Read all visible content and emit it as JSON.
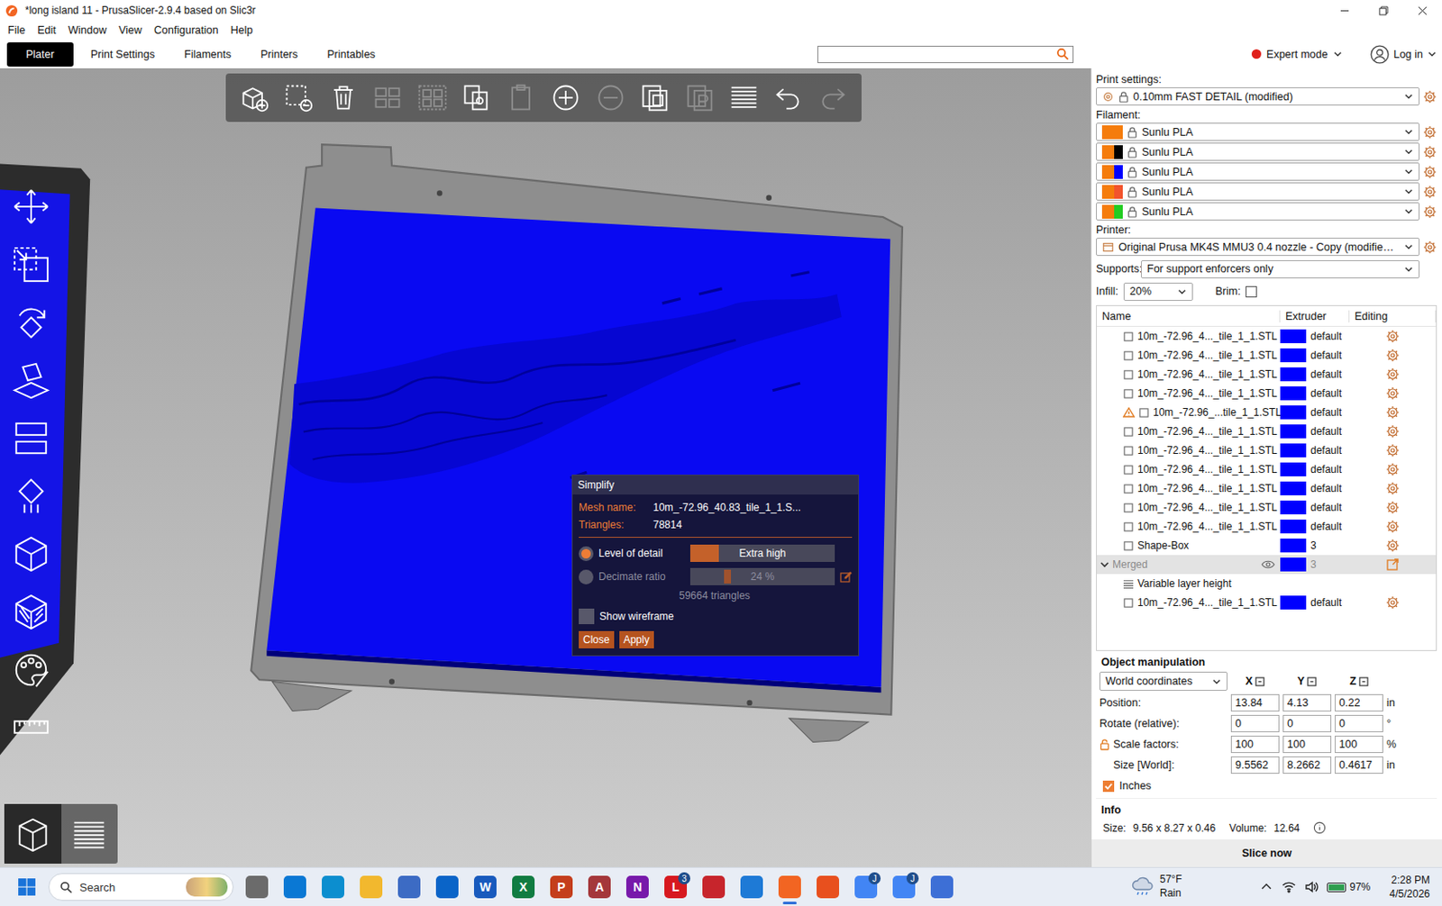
{
  "window": {
    "title": "*long island 11 - PrusaSlicer-2.9.4 based on Slic3r"
  },
  "menu": [
    "File",
    "Edit",
    "Window",
    "View",
    "Configuration",
    "Help"
  ],
  "tabs": [
    {
      "label": "Plater",
      "selected": true
    },
    {
      "label": "Print Settings",
      "selected": false
    },
    {
      "label": "Filaments",
      "selected": false
    },
    {
      "label": "Printers",
      "selected": false
    },
    {
      "label": "Printables",
      "selected": false
    }
  ],
  "mode": {
    "label": "Expert mode",
    "color": "#e0201b"
  },
  "login": "Log in",
  "toolbar": [
    {
      "kind": "add",
      "disabled": false
    },
    {
      "kind": "delete",
      "disabled": false
    },
    {
      "kind": "delete-all",
      "disabled": false
    },
    {
      "kind": "arrange",
      "disabled": true
    },
    {
      "kind": "arrange-selection",
      "disabled": true
    },
    {
      "kind": "copy",
      "disabled": false
    },
    {
      "kind": "paste",
      "disabled": true
    },
    {
      "kind": "add-instance",
      "disabled": false
    },
    {
      "kind": "remove-instance",
      "disabled": true
    },
    {
      "kind": "split-objects",
      "disabled": false
    },
    {
      "kind": "split-parts",
      "disabled": true
    },
    {
      "kind": "layers-editing",
      "disabled": false
    },
    {
      "kind": "undo",
      "disabled": false
    },
    {
      "kind": "redo",
      "disabled": true
    }
  ],
  "gizmos": [
    {
      "kind": "move",
      "selected": false
    },
    {
      "kind": "scale",
      "selected": false
    },
    {
      "kind": "rotate",
      "selected": false
    },
    {
      "kind": "place-on-face",
      "selected": false
    },
    {
      "kind": "cut",
      "selected": false
    },
    {
      "kind": "supports",
      "selected": false
    },
    {
      "kind": "seam",
      "selected": false
    },
    {
      "kind": "fuzzy-skin",
      "selected": false
    },
    {
      "kind": "mmu-paint",
      "selected": false
    },
    {
      "kind": "measure",
      "selected": false
    }
  ],
  "view_buttons": [
    {
      "kind": "3d-view",
      "selected": true
    },
    {
      "kind": "preview",
      "selected": false
    }
  ],
  "simplify": {
    "title": "Simplify",
    "mesh_name_label": "Mesh name:",
    "mesh_name": "10m_-72.96_40.83_tile_1_1.S...",
    "triangles_label": "Triangles:",
    "triangles": "78814",
    "options": [
      {
        "label": "Level of detail",
        "selected": true,
        "disabled": false,
        "value": "Extra high",
        "level": 0.2,
        "kind": "fill"
      },
      {
        "label": "Decimate ratio",
        "selected": false,
        "disabled": true,
        "value": "24 %",
        "level": 0.26,
        "kind": "handle"
      }
    ],
    "result": "59664 triangles",
    "wireframe": {
      "label": "Show wireframe",
      "checked": false
    },
    "buttons": [
      "Close",
      "Apply"
    ]
  },
  "print_settings": {
    "label": "Print settings:",
    "value": "0.10mm FAST DETAIL (modified)"
  },
  "filament": {
    "label": "Filament:",
    "items": [
      {
        "name": "Sunlu PLA",
        "color": "#f57c0c",
        "extruder_color": "#f57c0c"
      },
      {
        "name": "Sunlu PLA",
        "color": "#f57c0c",
        "extruder_color": "#000000"
      },
      {
        "name": "Sunlu PLA",
        "color": "#f57c0c",
        "extruder_color": "#0000ff"
      },
      {
        "name": "Sunlu PLA",
        "color": "#f57c0c",
        "extruder_color": "#f2542d"
      },
      {
        "name": "Sunlu PLA",
        "color": "#f57c0c",
        "extruder_color": "#22cc22"
      }
    ]
  },
  "printer": {
    "label": "Printer:",
    "value": "Original Prusa MK4S MMU3 0.4 nozzle - Copy (modifie…"
  },
  "supports": {
    "label": "Supports:",
    "value": "For support enforcers only"
  },
  "infill": {
    "label": "Infill:",
    "value": "20%"
  },
  "brim": {
    "label": "Brim:",
    "checked": false
  },
  "object_list": {
    "columns": [
      "Name",
      "Extruder",
      "Editing"
    ],
    "rows": [
      {
        "name": "10m_-72.96_4..._tile_1_1.STL",
        "kind": "part",
        "extruder": "default",
        "color": "#0000ff",
        "warning": false,
        "selected": false
      },
      {
        "name": "10m_-72.96_4..._tile_1_1.STL",
        "kind": "part",
        "extruder": "default",
        "color": "#0000ff",
        "warning": false,
        "selected": false
      },
      {
        "name": "10m_-72.96_4..._tile_1_1.STL",
        "kind": "part",
        "extruder": "default",
        "color": "#0000ff",
        "warning": false,
        "selected": false
      },
      {
        "name": "10m_-72.96_4..._tile_1_1.STL",
        "kind": "part",
        "extruder": "default",
        "color": "#0000ff",
        "warning": false,
        "selected": false
      },
      {
        "name": "10m_-72.96_...tile_1_1.STL",
        "kind": "part",
        "extruder": "default",
        "color": "#0000ff",
        "warning": true,
        "selected": false
      },
      {
        "name": "10m_-72.96_4..._tile_1_1.STL",
        "kind": "part",
        "extruder": "default",
        "color": "#0000ff",
        "warning": false,
        "selected": false
      },
      {
        "name": "10m_-72.96_4..._tile_1_1.STL",
        "kind": "part",
        "extruder": "default",
        "color": "#0000ff",
        "warning": false,
        "selected": false
      },
      {
        "name": "10m_-72.96_4..._tile_1_1.STL",
        "kind": "part",
        "extruder": "default",
        "color": "#0000ff",
        "warning": false,
        "selected": false
      },
      {
        "name": "10m_-72.96_4..._tile_1_1.STL",
        "kind": "part",
        "extruder": "default",
        "color": "#0000ff",
        "warning": false,
        "selected": false
      },
      {
        "name": "10m_-72.96_4..._tile_1_1.STL",
        "kind": "part",
        "extruder": "default",
        "color": "#0000ff",
        "warning": false,
        "selected": false
      },
      {
        "name": "10m_-72.96_4..._tile_1_1.STL",
        "kind": "part",
        "extruder": "default",
        "color": "#0000ff",
        "warning": false,
        "selected": false
      },
      {
        "name": "Shape-Box",
        "kind": "part",
        "extruder": "3",
        "color": "#0000ff",
        "warning": false,
        "selected": false
      },
      {
        "name": "Merged",
        "kind": "object",
        "extruder": "3",
        "color": "#0000ff",
        "warning": false,
        "selected": true,
        "expanded": true,
        "visible": true
      },
      {
        "name": "Variable layer height",
        "kind": "layers",
        "warning": false,
        "selected": false
      },
      {
        "name": "10m_-72.96_4..._tile_1_1.STL",
        "kind": "part",
        "extruder": "default",
        "color": "#0000ff",
        "warning": false,
        "selected": false
      }
    ]
  },
  "manipulation": {
    "title": "Object manipulation",
    "coord_system": "World coordinates",
    "axes": [
      "X",
      "Y",
      "Z"
    ],
    "rows": [
      {
        "label": "Position:",
        "values": [
          "13.84",
          "4.13",
          "0.22"
        ],
        "unit": "in",
        "lock_group": false
      },
      {
        "label": "Rotate (relative):",
        "values": [
          "0",
          "0",
          "0"
        ],
        "unit": "°",
        "lock_group": false
      },
      {
        "label": "Scale factors:",
        "values": [
          "100",
          "100",
          "100"
        ],
        "unit": "%",
        "lock_group": true
      },
      {
        "label": "Size [World]:",
        "values": [
          "9.5562",
          "8.2662",
          "0.4617"
        ],
        "unit": "in",
        "lock_group": true
      }
    ],
    "locked": false,
    "inches": {
      "label": "Inches",
      "checked": true
    }
  },
  "info": {
    "title": "Info",
    "size_label": "Size:",
    "size": "9.56 x 8.27 x 0.46",
    "volume_label": "Volume:",
    "volume": "12.64"
  },
  "slice_button": "Slice now",
  "taskbar": {
    "search": "Search",
    "apps": [
      {
        "kind": "task-view",
        "color": "#6b6b6b",
        "active": false
      },
      {
        "kind": "store",
        "color": "#0a78d4",
        "active": false
      },
      {
        "kind": "edge",
        "color": "#0c8ecf",
        "active": false
      },
      {
        "kind": "explorer",
        "color": "#f2b82e",
        "active": false
      },
      {
        "kind": "snipping",
        "color": "#3c6bc4",
        "active": false
      },
      {
        "kind": "outlook",
        "color": "#0a64c8",
        "active": false
      },
      {
        "kind": "word",
        "glyph": "W",
        "color": "#185abd",
        "active": false
      },
      {
        "kind": "excel",
        "glyph": "X",
        "color": "#107c41",
        "active": false
      },
      {
        "kind": "powerpoint",
        "glyph": "P",
        "color": "#c43e1c",
        "active": false
      },
      {
        "kind": "access",
        "glyph": "A",
        "color": "#a4373a",
        "active": false
      },
      {
        "kind": "onenote",
        "glyph": "N",
        "color": "#7719aa",
        "active": false
      },
      {
        "kind": "lapp",
        "glyph": "L",
        "badge": "3",
        "color": "#d7191f",
        "active": false
      },
      {
        "kind": "red-app",
        "color": "#c7252c",
        "active": false
      },
      {
        "kind": "publisher",
        "color": "#1e7ad6",
        "active": false
      },
      {
        "kind": "prusaslicer",
        "color": "#f26522",
        "active": true
      },
      {
        "kind": "burst",
        "color": "#e8501e",
        "active": false
      },
      {
        "kind": "chrome",
        "badge": "J",
        "color": "#4285f4",
        "active": false
      },
      {
        "kind": "chrome",
        "badge": "J",
        "color": "#4285f4",
        "active": false
      },
      {
        "kind": "todo",
        "color": "#3d6fd6",
        "active": false
      }
    ],
    "weather": {
      "temp": "57°F",
      "desc": "Rain"
    },
    "battery": {
      "label": "97%",
      "level": 0.97
    },
    "time": "2:28 PM",
    "date": "4/5/2026"
  }
}
